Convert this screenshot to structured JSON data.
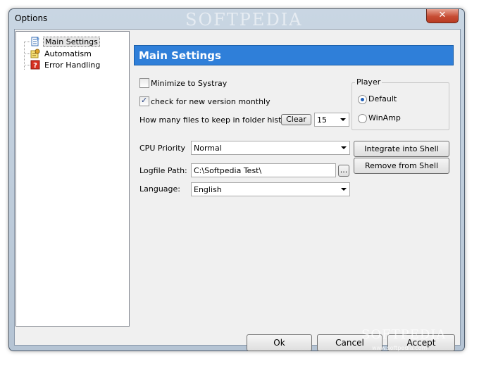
{
  "window": {
    "title": "Options",
    "title_watermark": "SOFTPEDIA",
    "close_label": "✕"
  },
  "tree": {
    "items": [
      {
        "label": "Main Settings",
        "icon": "document-icon",
        "selected": true
      },
      {
        "label": "Automatism",
        "icon": "automatism-icon",
        "selected": false
      },
      {
        "label": "Error Handling",
        "icon": "help-icon",
        "selected": false
      }
    ]
  },
  "panel": {
    "title": "Main Settings",
    "minimize_to_systray": {
      "label": "Minimize to Systray",
      "checked": false
    },
    "check_version": {
      "label": "check for new version monthly",
      "checked": true
    },
    "history": {
      "label": "How many files to keep in folder history:",
      "clear_label": "Clear",
      "value": "15"
    },
    "player": {
      "title": "Player",
      "options": [
        {
          "label": "Default",
          "selected": true
        },
        {
          "label": "WinAmp",
          "selected": false
        }
      ]
    },
    "cpu_priority": {
      "label": "CPU Priority",
      "value": "Normal"
    },
    "logfile": {
      "label": "Logfile Path:",
      "value": "C:\\Softpedia Test\\",
      "browse_label": "..."
    },
    "language": {
      "label": "Language:",
      "value": "English"
    },
    "shell": {
      "integrate_label": "Integrate into Shell",
      "remove_label": "Remove from Shell"
    }
  },
  "footer": {
    "ok_label": "Ok",
    "cancel_label": "Cancel",
    "accept_label": "Accept",
    "watermark": "SOFTPEDIA",
    "watermark_url": "www.softpedia.com"
  },
  "colors": {
    "header_blue": "#2f7fd9",
    "close_red": "#c74d34"
  }
}
